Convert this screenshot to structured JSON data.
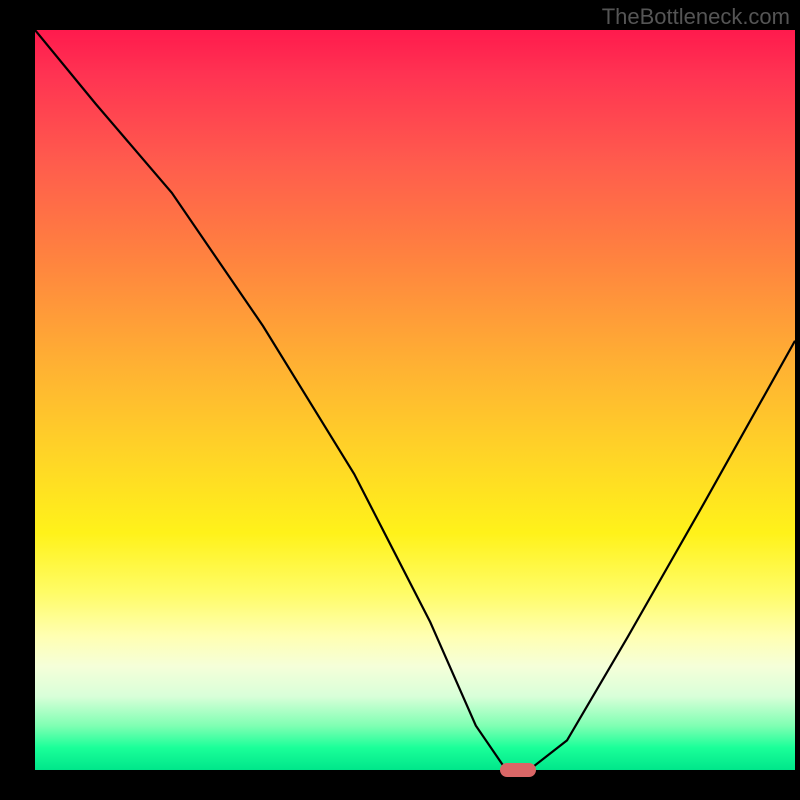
{
  "watermark": "TheBottleneck.com",
  "chart_data": {
    "type": "line",
    "title": "",
    "xlabel": "",
    "ylabel": "",
    "xlim": [
      0,
      100
    ],
    "ylim": [
      0,
      100
    ],
    "series": [
      {
        "name": "bottleneck-curve",
        "x": [
          0,
          8,
          18,
          30,
          42,
          52,
          58,
          62,
          65,
          70,
          78,
          88,
          100
        ],
        "values": [
          100,
          90,
          78,
          60,
          40,
          20,
          6,
          0,
          0,
          4,
          18,
          36,
          58
        ]
      }
    ],
    "marker": {
      "x": 63.5,
      "y": 0
    },
    "background_gradient": {
      "top": "#ff1a4d",
      "mid": "#ffd626",
      "bottom": "#00e68a"
    }
  }
}
